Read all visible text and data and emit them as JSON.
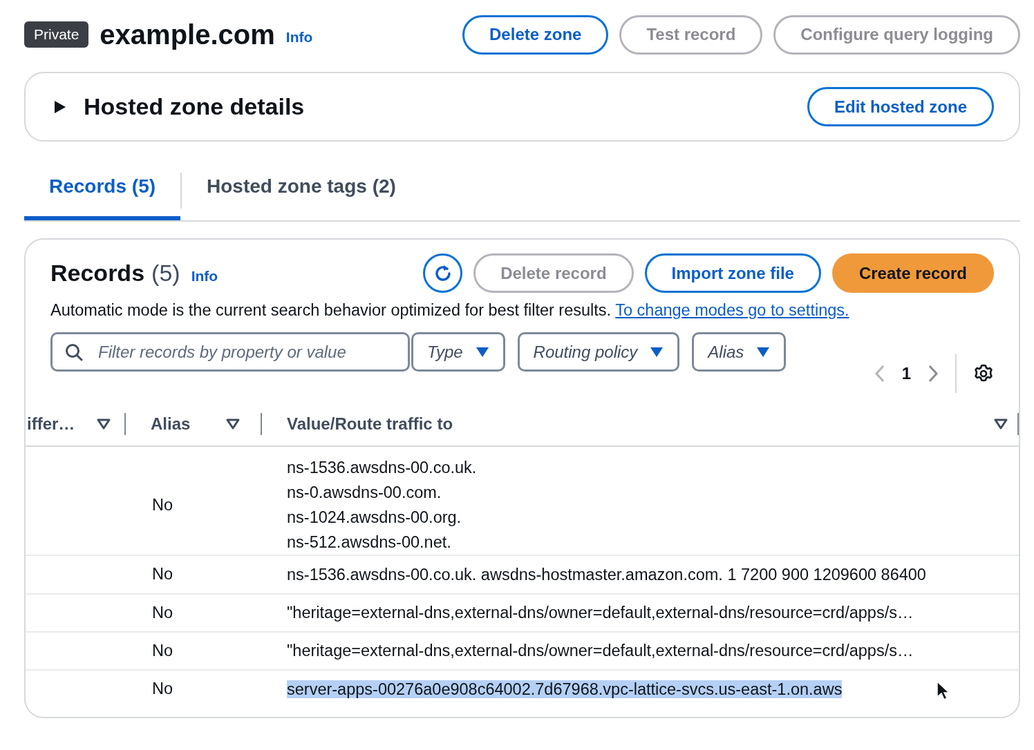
{
  "header": {
    "badge": "Private",
    "title": "example.com",
    "info": "Info",
    "buttons": [
      {
        "label": "Delete zone",
        "disabled": false
      },
      {
        "label": "Test record",
        "disabled": true
      },
      {
        "label": "Configure query logging",
        "disabled": true
      }
    ]
  },
  "details": {
    "title": "Hosted zone details",
    "expanded": false,
    "button": "Edit hosted zone"
  },
  "tabs": [
    {
      "label": "Records (5)",
      "selected": true
    },
    {
      "label": "Hosted zone tags (2)",
      "selected": false
    }
  ],
  "records": {
    "title": "Records",
    "count": "(5)",
    "info": "Info",
    "buttons": [
      {
        "kind": "refresh",
        "disabled": false
      },
      {
        "kind": "normal",
        "label": "Delete record",
        "disabled": true
      },
      {
        "kind": "normal",
        "label": "Import zone file",
        "disabled": false
      },
      {
        "kind": "primary",
        "label": "Create record",
        "disabled": false
      }
    ],
    "notice": "Automatic mode is the current search behavior optimized for best filter results.",
    "notice_link": "To change modes go to settings.",
    "search": {
      "placeholder": "Filter records by property or value"
    },
    "filters": [
      "Type",
      "Routing policy",
      "Alias"
    ],
    "page": "1",
    "columns": [
      "iffer…",
      "Alias",
      "Value/Route traffic to"
    ],
    "rows": [
      {
        "alias": "No",
        "values": [
          "ns-1536.awsdns-00.co.uk.",
          "ns-0.awsdns-00.com.",
          "ns-1024.awsdns-00.org.",
          "ns-512.awsdns-00.net."
        ],
        "highlighted": false
      },
      {
        "alias": "No",
        "values": [
          "ns-1536.awsdns-00.co.uk. awsdns-hostmaster.amazon.com. 1 7200 900 1209600 86400"
        ],
        "highlighted": false
      },
      {
        "alias": "No",
        "values": [
          "\"heritage=external-dns,external-dns/owner=default,external-dns/resource=crd/apps/s…"
        ],
        "highlighted": false
      },
      {
        "alias": "No",
        "values": [
          "\"heritage=external-dns,external-dns/owner=default,external-dns/resource=crd/apps/s…"
        ],
        "highlighted": false
      },
      {
        "alias": "No",
        "values": [
          "server-apps-00276a0e908c64002.7d67968.vpc-lattice-svcs.us-east-1.on.aws"
        ],
        "highlighted": true
      }
    ]
  }
}
